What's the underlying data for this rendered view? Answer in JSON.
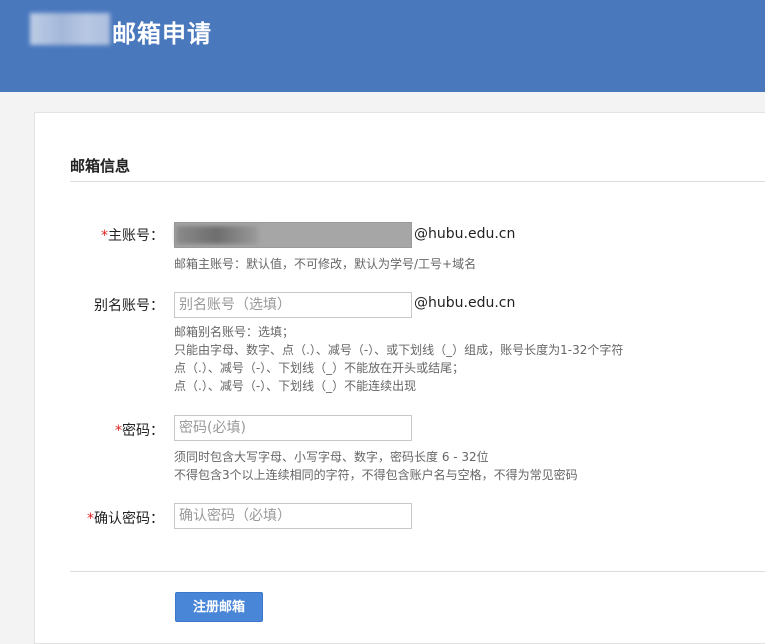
{
  "header": {
    "title": "邮箱申请"
  },
  "section": {
    "title": "邮箱信息"
  },
  "fields": {
    "main_account": {
      "required_mark": "*",
      "label": "主账号：",
      "value": "",
      "suffix": "@hubu.edu.cn",
      "hint": "邮箱主账号：默认值，不可修改，默认为学号/工号+域名"
    },
    "alias_account": {
      "label": "别名账号：",
      "placeholder": "别名账号（选填）",
      "suffix": "@hubu.edu.cn",
      "hints": [
        "邮箱别名账号：选填；",
        "只能由字母、数字、点（.）、减号（-）、或下划线（_）组成，账号长度为1-32个字符",
        "点（.）、减号（-）、下划线（_）不能放在开头或结尾；",
        "点（.）、减号（-）、下划线（_）不能连续出现"
      ]
    },
    "password": {
      "required_mark": "*",
      "label": "密码：",
      "placeholder": "密码(必填)",
      "hints": [
        "须同时包含大写字母、小写字母、数字，密码长度 6 - 32位",
        "不得包含3个以上连续相同的字符，不得包含账户名与空格，不得为常见密码"
      ]
    },
    "confirm_password": {
      "required_mark": "*",
      "label": "确认密码：",
      "placeholder": "确认密码（必填）"
    }
  },
  "actions": {
    "submit_label": "注册邮箱"
  },
  "colors": {
    "header_bg": "#4a78bd",
    "button_bg": "#4a86d8",
    "required": "#e02020"
  }
}
